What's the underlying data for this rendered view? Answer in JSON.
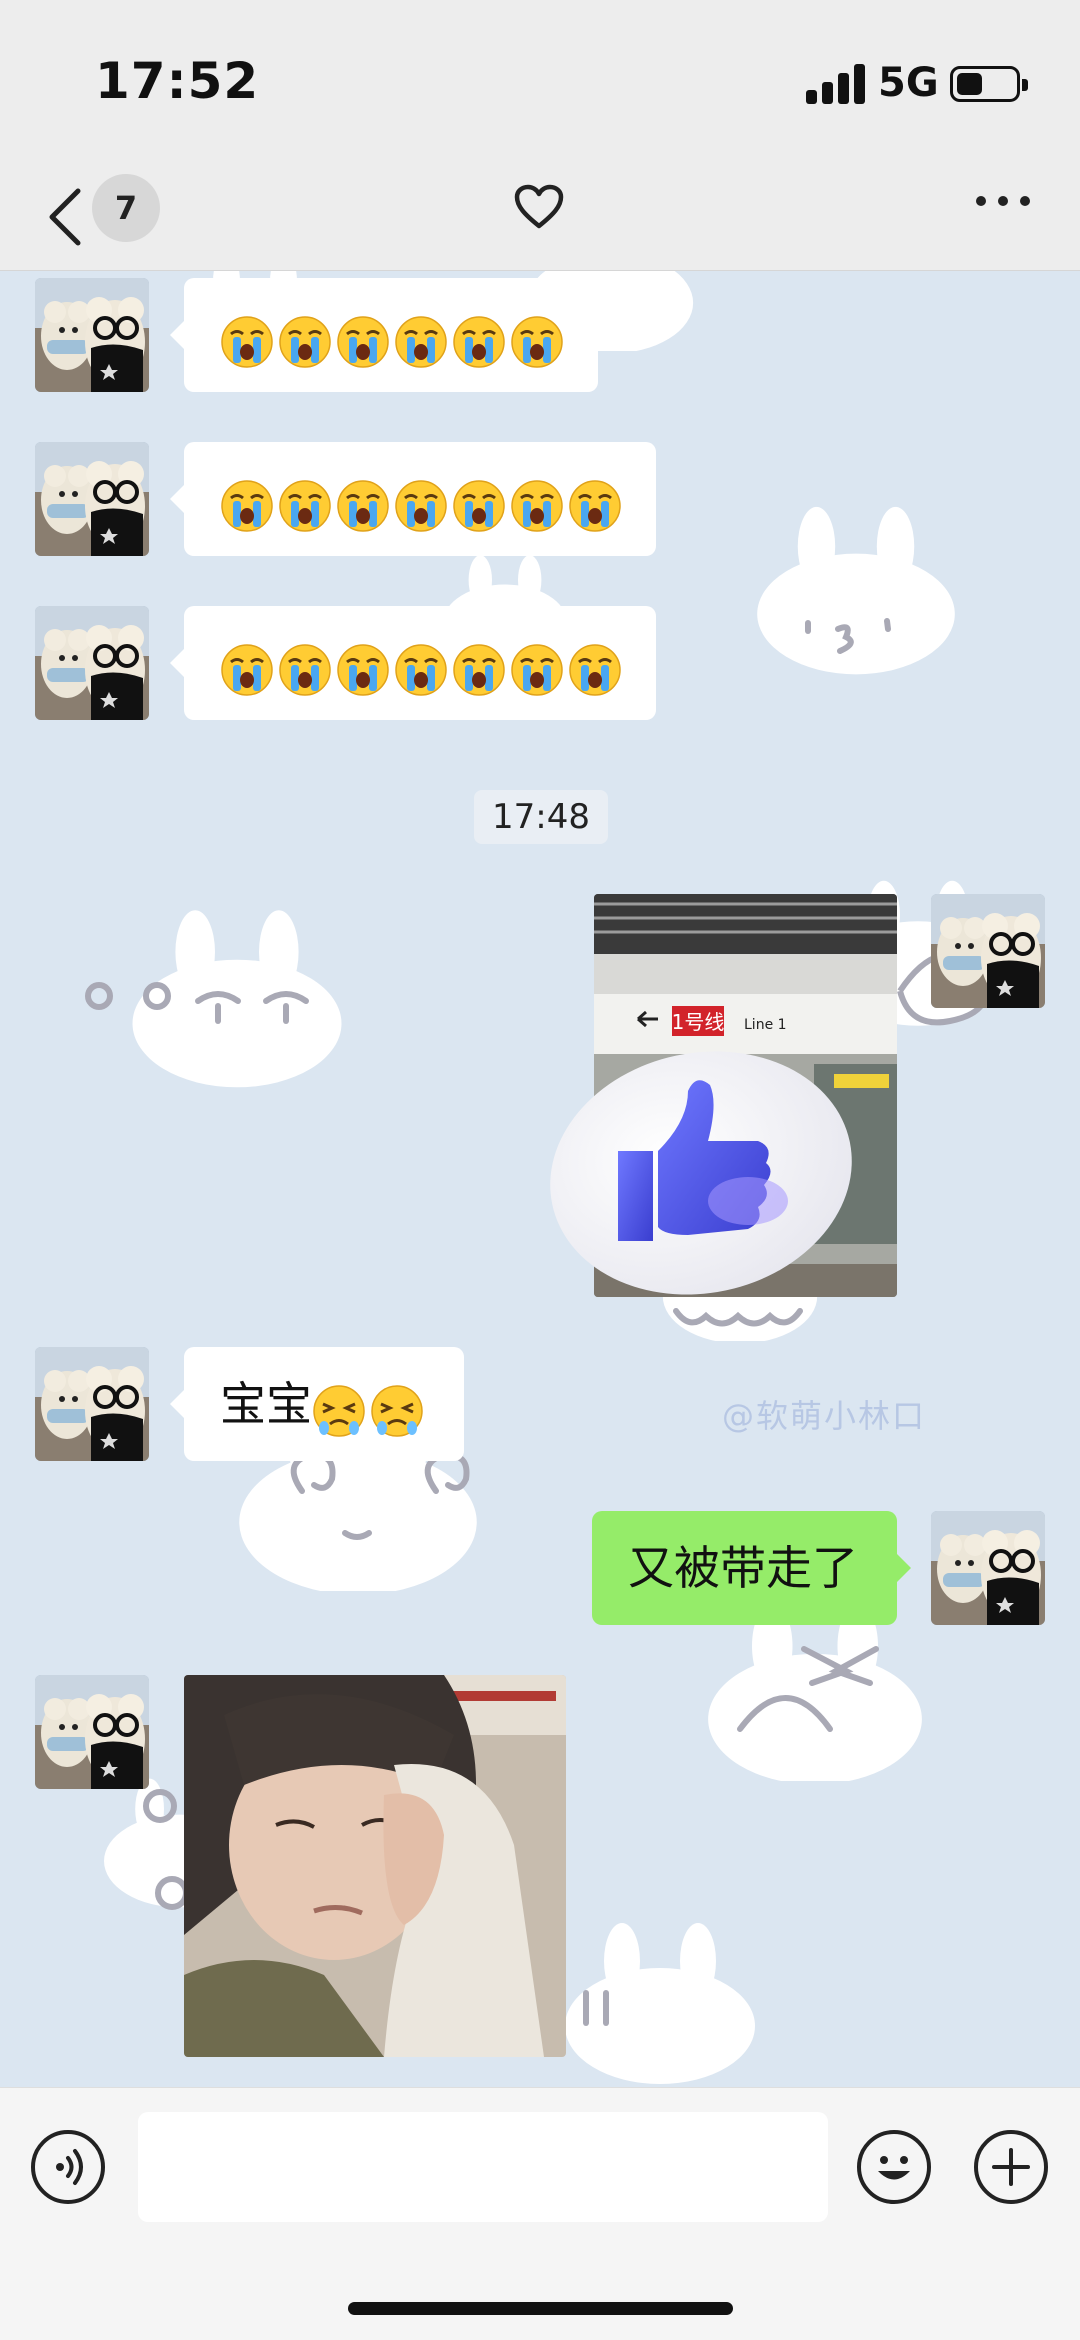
{
  "status_bar": {
    "time": "17:52",
    "network": "5G",
    "battery_level": 0.45
  },
  "nav": {
    "unread_count": "7",
    "back_icon": "chevron-left-icon",
    "favorite_icon": "heart-icon",
    "more_icon": "ellipsis-icon"
  },
  "messages": [
    {
      "side": "left",
      "type": "emoji",
      "emoji_name": "loudly-crying-face",
      "count": 6
    },
    {
      "side": "left",
      "type": "emoji",
      "emoji_name": "loudly-crying-face",
      "count": 7
    },
    {
      "side": "left",
      "type": "emoji",
      "emoji_name": "loudly-crying-face",
      "count": 7
    },
    {
      "type": "timestamp",
      "text": "17:48"
    },
    {
      "side": "right",
      "type": "image",
      "content": "subway-platform-photo",
      "sticker": "thumbs-up",
      "sign_text": "1号线",
      "sign_line": "Line 1"
    },
    {
      "side": "left",
      "type": "text",
      "text": "宝宝",
      "emoji_name": "tired-face",
      "emoji_count": 2
    },
    {
      "side": "right",
      "type": "text",
      "text": "又被带走了"
    },
    {
      "side": "left",
      "type": "image",
      "content": "crying-child-photo"
    }
  ],
  "background": {
    "watermark": "@软萌小林口"
  },
  "input_bar": {
    "voice_icon": "voice-icon",
    "emoji_icon": "smiley-icon",
    "plus_icon": "plus-icon",
    "input_value": ""
  },
  "colors": {
    "bubble_sent": "#95ec69",
    "bubble_received": "#ffffff",
    "chat_background": "#dbe6f1",
    "nav_background": "#ededed"
  }
}
